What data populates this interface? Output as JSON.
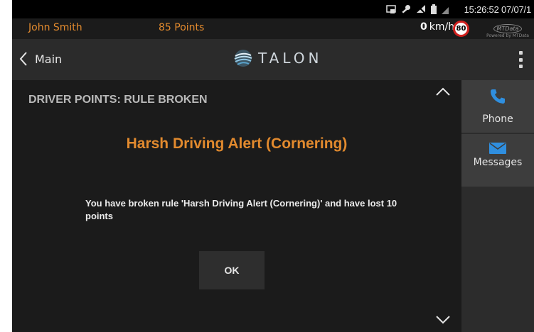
{
  "status_bar": {
    "clock": "15:26:52 07/07/1",
    "icons": [
      "cast-icon",
      "key-icon",
      "signal-off-icon",
      "battery-icon",
      "cell-signal-icon"
    ]
  },
  "driver_bar": {
    "driver_name": "John Smith",
    "points": "85 Points",
    "speed_value": "0",
    "speed_unit": "km/h",
    "speed_limit": "80",
    "brand_logo": "MTData",
    "brand_sub": "Powered by MTData"
  },
  "nav": {
    "back_label": "Main",
    "app_title": "TALON"
  },
  "dialog": {
    "heading": "DRIVER POINTS: RULE BROKEN",
    "alert_title": "Harsh Driving Alert (Cornering)",
    "message": "You have broken rule 'Harsh Driving Alert (Cornering)' and have lost 10 points",
    "ok_label": "OK"
  },
  "side_panel": {
    "phone_label": "Phone",
    "messages_label": "Messages"
  },
  "colors": {
    "accent_orange": "#e28a2e",
    "icon_blue": "#2f8fe0",
    "speed_limit_red": "#d0201e"
  }
}
